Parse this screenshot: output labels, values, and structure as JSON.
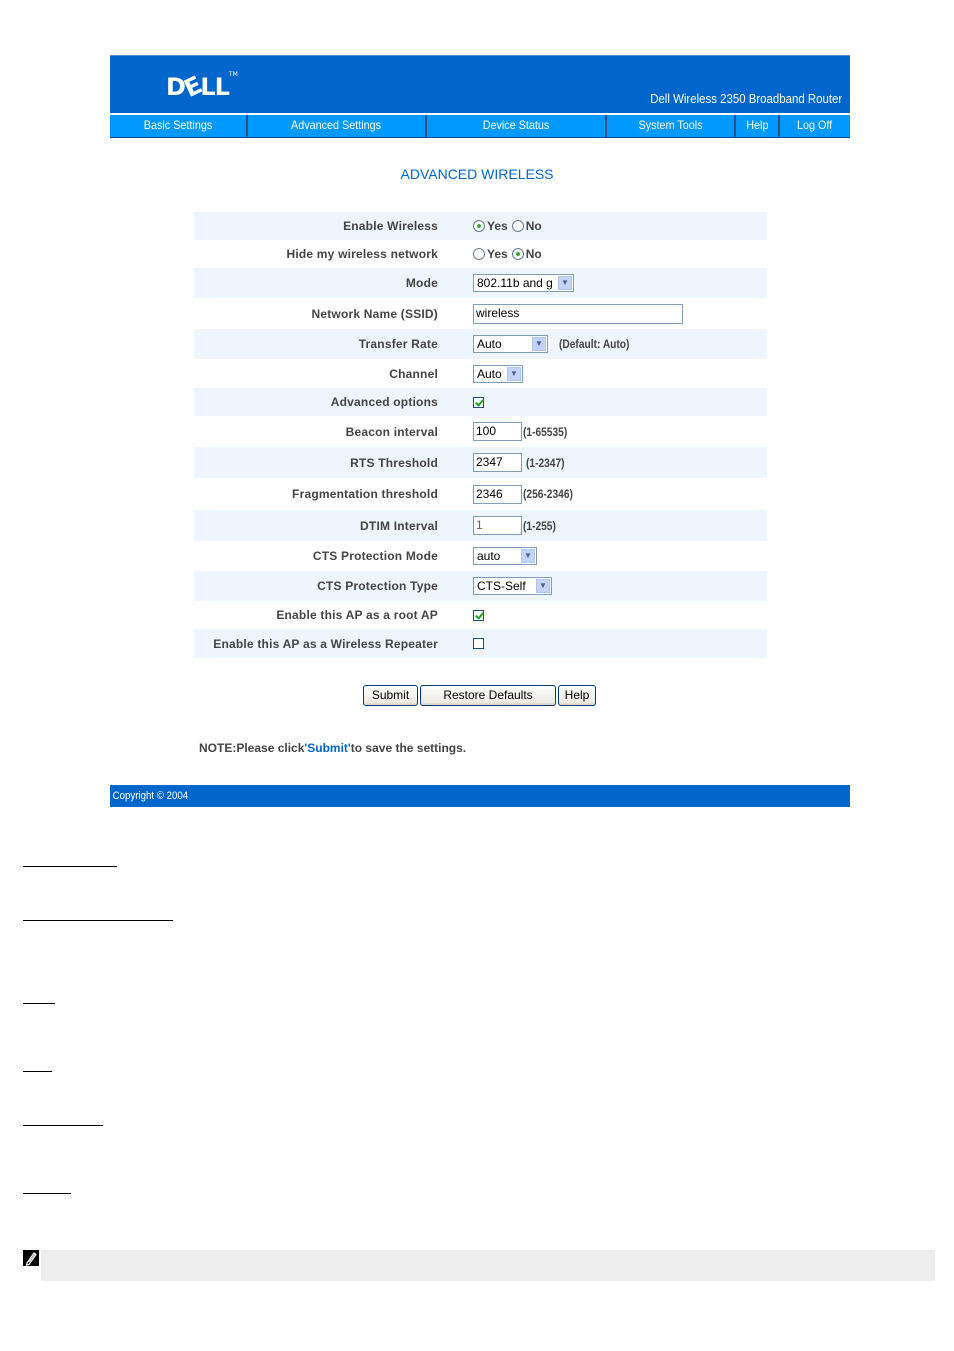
{
  "header": {
    "logo_text": "DELL",
    "logo_tm": "TM",
    "product_name": "Dell Wireless 2350 Broadband Router",
    "brand_color": "#0066cc",
    "nav_color": "#0099ff"
  },
  "nav": [
    {
      "label": "Basic Settings"
    },
    {
      "label": "Advanced Settings"
    },
    {
      "label": "Device Status"
    },
    {
      "label": "System Tools"
    },
    {
      "label": "Help"
    },
    {
      "label": "Log Off"
    }
  ],
  "page": {
    "title": "ADVANCED WIRELESS"
  },
  "form": {
    "enable_wireless": {
      "label": "Enable Wireless",
      "options": [
        "Yes",
        "No"
      ],
      "selected": "Yes"
    },
    "hide_network": {
      "label": "Hide my wireless network",
      "options": [
        "Yes",
        "No"
      ],
      "selected": "No"
    },
    "mode": {
      "label": "Mode",
      "value": "802.11b and g"
    },
    "ssid": {
      "label": "Network Name (SSID)",
      "value": "wireless"
    },
    "transfer_rate": {
      "label": "Transfer Rate",
      "value": "Auto",
      "hint": "(Default: Auto)"
    },
    "channel": {
      "label": "Channel",
      "value": "Auto"
    },
    "advanced_options": {
      "label": "Advanced options",
      "checked": true
    },
    "beacon_interval": {
      "label": "Beacon interval",
      "value": "100",
      "hint": "(1-65535)"
    },
    "rts_threshold": {
      "label": "RTS Threshold",
      "value": "2347",
      "hint": "(1-2347)"
    },
    "frag_threshold": {
      "label": "Fragmentation threshold",
      "value": "2346",
      "hint": "(256-2346)"
    },
    "dtim_interval": {
      "label": "DTIM Interval",
      "value": "1",
      "hint": "(1-255)"
    },
    "cts_mode": {
      "label": "CTS Protection Mode",
      "value": "auto"
    },
    "cts_type": {
      "label": "CTS Protection Type",
      "value": "CTS-Self"
    },
    "root_ap": {
      "label": "Enable this AP as a root AP",
      "checked": true
    },
    "repeater": {
      "label": "Enable this AP as a Wireless Repeater",
      "checked": false
    }
  },
  "buttons": {
    "submit": "Submit",
    "restore": "Restore Defaults",
    "help": "Help"
  },
  "note": {
    "prefix": "NOTE:Please click",
    "link": "'Submit'",
    "suffix": "to save the settings."
  },
  "footer": {
    "copyright": "Copyright © 2004"
  }
}
